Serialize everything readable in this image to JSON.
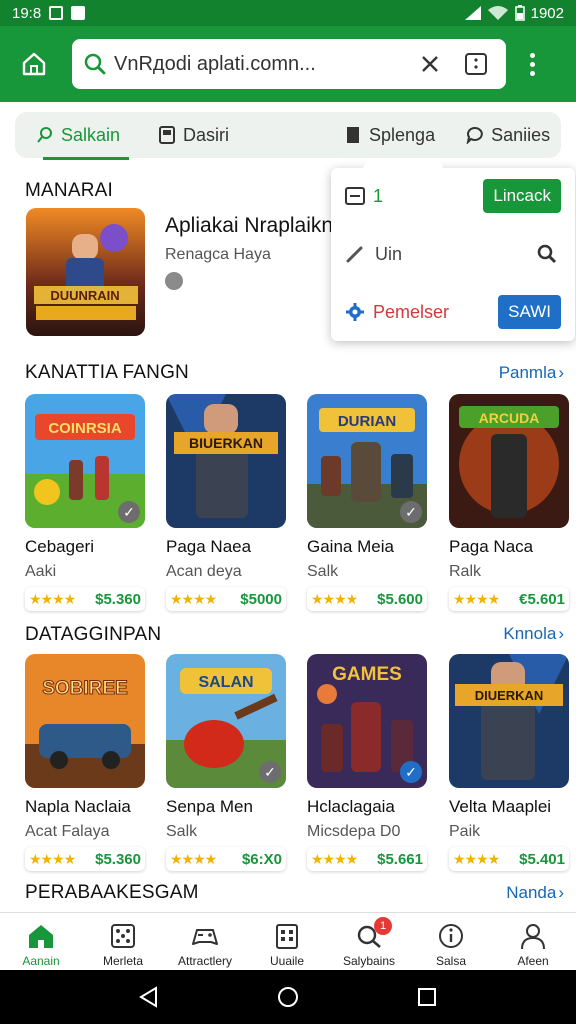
{
  "status": {
    "time": "19:8",
    "right_text": "1902"
  },
  "search": {
    "value": "VnRдodi aplati.comn..."
  },
  "tabs": [
    {
      "label": "Salkain",
      "icon": "search-icon"
    },
    {
      "label": "Dasiri",
      "icon": "tablet-icon"
    },
    {
      "label": "Splenga",
      "icon": "document-icon"
    },
    {
      "label": "Saniies",
      "icon": "chat-icon"
    }
  ],
  "featured": {
    "section_title": "MANARAI",
    "app_name": "Apliakai Nraplaikn",
    "developer": "Renagca Haya"
  },
  "popup": {
    "row1_value": "1",
    "row1_button": "Lincack",
    "row2_label": "Uin",
    "row3_label": "Pemelser",
    "row3_button": "SAWI"
  },
  "section2": {
    "title": "KANATTIA FANGN",
    "link": "Panmla",
    "cards": [
      {
        "name": "Cebageri",
        "sub": "Aaki",
        "stars": "★★★★",
        "price": "$5.360",
        "art_text": "COINRSIA",
        "check": "gray"
      },
      {
        "name": "Paga Naea",
        "sub": "Acan deya",
        "stars": "★★★★",
        "price": "$5000",
        "art_text": "BIUERKAN",
        "check": "none"
      },
      {
        "name": "Gaina Meia",
        "sub": "Salk",
        "stars": "★★★★",
        "price": "$5.600",
        "art_text": "DURIAN",
        "check": "gray"
      },
      {
        "name": "Paga Naca",
        "sub": "Ralk",
        "stars": "★★★★",
        "price": "€5.601",
        "art_text": "ARCUDA",
        "check": "none"
      }
    ]
  },
  "section3": {
    "title": "DATAGGINPAN",
    "link": "Knnola",
    "cards": [
      {
        "name": "Napla Naclaia",
        "sub": "Acat Falaya",
        "stars": "★★★★",
        "price": "$5.360",
        "art_text": "SOBIREE",
        "check": "none"
      },
      {
        "name": "Senpa Men",
        "sub": "Salk",
        "stars": "★★★★",
        "price": "$6:X0",
        "art_text": "SALAN",
        "check": "gray"
      },
      {
        "name": "Hclaclagaia",
        "sub": "Micsdepa D0",
        "stars": "★★★★",
        "price": "$5.661",
        "art_text": "GAMES",
        "check": "blue"
      },
      {
        "name": "Velta Maaplei",
        "sub": "Paik",
        "stars": "★★★★",
        "price": "$5.401",
        "art_text": "DIUERKAN",
        "check": "none"
      }
    ]
  },
  "section4": {
    "title": "PERABAAKESGAM",
    "link": "Nanda"
  },
  "bottom_nav": [
    {
      "label": "Aanain",
      "icon": "home-icon"
    },
    {
      "label": "Merleta",
      "icon": "dice-icon"
    },
    {
      "label": "Attractlery",
      "icon": "gamepad-icon"
    },
    {
      "label": "Uuaile",
      "icon": "calendar-icon"
    },
    {
      "label": "Salybains",
      "icon": "search-icon",
      "badge": "1"
    },
    {
      "label": "Salsa",
      "icon": "info-icon"
    },
    {
      "label": "Afeen",
      "icon": "profile-icon"
    }
  ],
  "colors": {
    "primary_green": "#18963a",
    "status_green": "#12822f",
    "link_blue": "#1767b3",
    "star_gold": "#f2b300"
  }
}
